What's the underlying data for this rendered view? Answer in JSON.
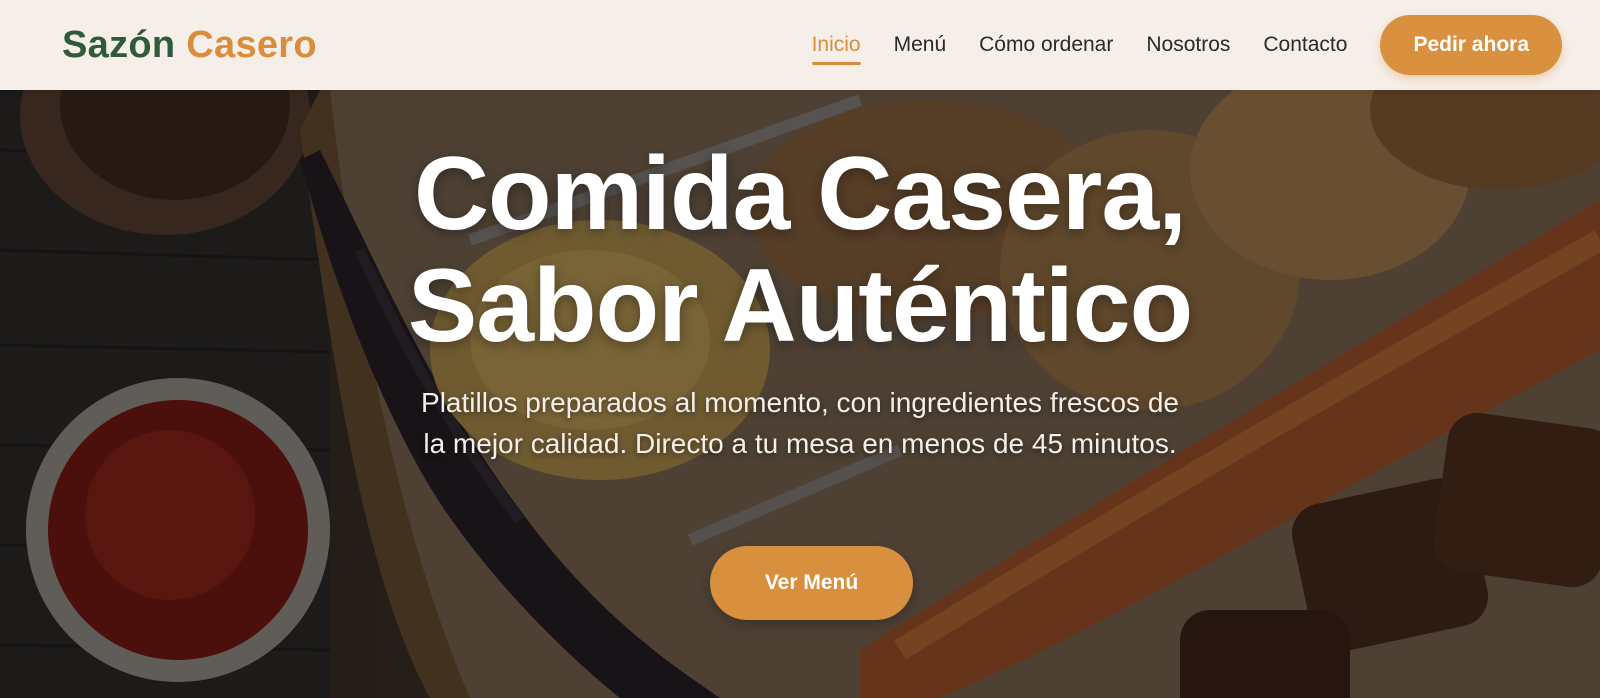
{
  "brand": {
    "name_part1": "Sazón",
    "name_part2": "Casero",
    "color_primary": "#2f5a3b",
    "color_accent": "#db8d3e"
  },
  "nav": {
    "items": [
      {
        "label": "Inicio",
        "active": true
      },
      {
        "label": "Menú",
        "active": false
      },
      {
        "label": "Cómo ordenar",
        "active": false
      },
      {
        "label": "Nosotros",
        "active": false
      },
      {
        "label": "Contacto",
        "active": false
      }
    ],
    "cta_label": "Pedir ahora"
  },
  "hero": {
    "title_line1": "Comida Casera,",
    "title_line2": "Sabor Auténtico",
    "subtitle": "Platillos preparados al momento, con ingredientes frescos de la mejor calidad. Directo a tu mesa en menos de 45 minutos.",
    "cta_label": "Ver Menú",
    "background_image": "grilled-meat-platter-photo"
  }
}
